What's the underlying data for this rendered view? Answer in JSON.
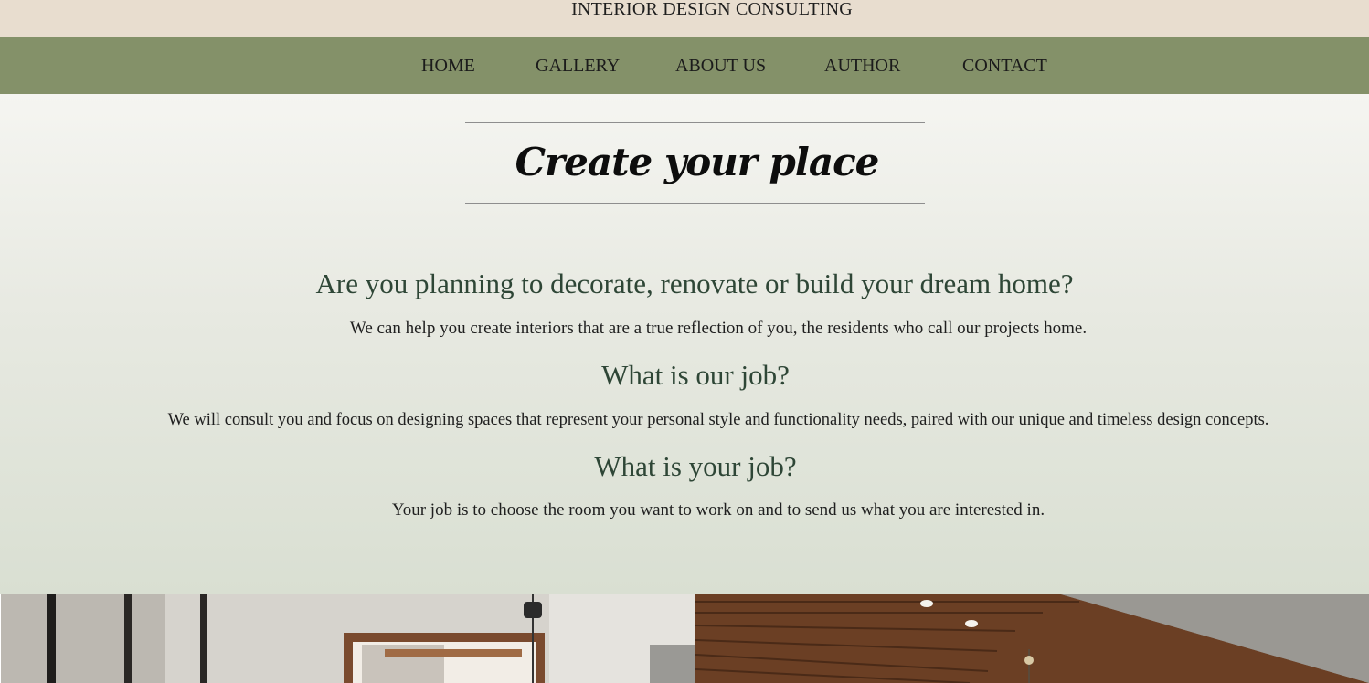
{
  "header": {
    "brand": "INTERIOR DESIGN CONSULTING"
  },
  "nav": {
    "items": [
      {
        "label": "HOME"
      },
      {
        "label": "GALLERY"
      },
      {
        "label": "ABOUT US"
      },
      {
        "label": "AUTHOR"
      },
      {
        "label": "CONTACT"
      }
    ]
  },
  "hero": {
    "title": "Create your place",
    "sections": [
      {
        "question": "Are you planning to decorate, renovate or build your dream home?",
        "text": "We can help you create interiors that are a true reflection of you, the residents who call our projects home."
      },
      {
        "question": "What is our job?",
        "text": "We will consult you and focus on designing spaces that represent your personal style and functionality needs, paired with our unique and timeless design concepts."
      },
      {
        "question": "What is your job?",
        "text": "Your job is to choose the room you want to work on and to send us what you are interested in."
      }
    ]
  },
  "colors": {
    "top_bar": "#e8ddcf",
    "nav_bar": "#849169",
    "heading": "#2e4636"
  }
}
